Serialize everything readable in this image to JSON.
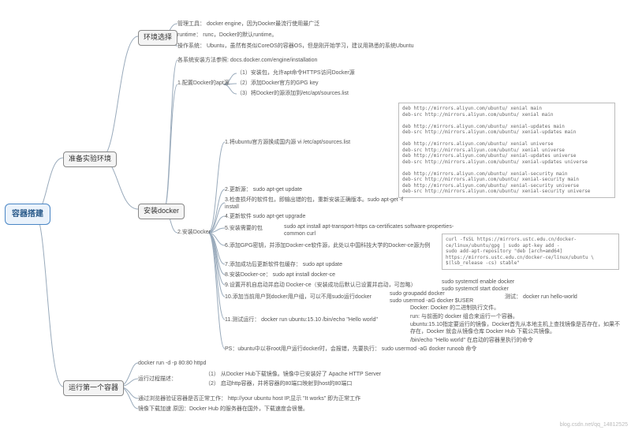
{
  "root": "容器搭建",
  "prep": "准备实验环境",
  "env": {
    "title": "环境选择",
    "tool": "管理工具： docker engine，因为Docker最流行使用最广泛",
    "runtime": "runtime： runc，Docker的默认runtime。",
    "os": "操作系统： Ubuntu，虽然有类似CoreOS的容器OS，但是刚开始学习，建议用熟悉的系统Ubuntu"
  },
  "install": {
    "title": "安装docker",
    "docs": "各系统安装方法参照: docs.docker.com/engine/installation",
    "apt": {
      "title": "1.配置Docker的apt源",
      "s1": "（1）安装包，允许apt命令HTTPS访问Docker源",
      "s2": "（2）添加Docker官方的GPG key",
      "s3": "（3）将Docker的源添加到/etc/apt/sources.list"
    },
    "do": {
      "title": "2.安装Docker",
      "s1": "1.将ubuntu官方源换成国内源 vi /etc/apt/sources.list",
      "s2": "2.更新源： sudo apt-get update",
      "s3": "3.检查损坏的软件包，即输出错的包，重新安装正确版本。sudo apt-get -f install",
      "s4": "4.更新软件 sudo apt-get upgrade",
      "s5": "5.安装需要的包",
      "s5cmd": "sudo apt install apt-transport-https ca-certificates software-properties-common curl",
      "s6": "6.添加GPG密钥，并添加Docker-ce软件源，此处以中国科技大学的Docker-ce源为例",
      "s7": "7.添加成功后更新软件包缓存： sudo apt update",
      "s8": "8.安装Docker-ce： sudo apt install docker-ce",
      "s9": "9.设置开机自启动并启动 Docker-ce（安装成功后默认已设置并启动，可忽略）",
      "s9cmd": "sudo systemctl enable docker\nsudo systemctl start docker",
      "s10": "10.添加当前用户到docker用户组，可以不用sudo运行docker",
      "s10cmd": "sudo groupadd docker\nsudo usermod -aG docker $USER",
      "s10test": "测试： docker run hello-world",
      "s11": "11.测试运行：   docker run ubuntu:15.10 /bin/echo \"Hello world\"",
      "s11a": "Docker: Docker 的二进制执行文件。",
      "s11b": "run: 与前面的 docker 组合来运行一个容器。",
      "s11c": "ubuntu:15.10指定要运行的镜像，Docker首先从本地主机上查找镜像是否存在，如果不存在，Docker 就会从镜像仓库 Docker Hub 下载公共镜像。",
      "s11d": "/bin/echo \"Hello world\"  在启动的容器里执行的命令",
      "sps": "PS：ubuntu中以非root用户运行docker时，会报错，先要执行：  sudo usermod -aG docker runoob 命令"
    }
  },
  "run": {
    "title": "运行第一个容器",
    "cmd": "docker run -d -p 80:80 httpd",
    "desc": "运行过程描述：",
    "d1": "（1） 从Docker Hub下载镜像。镜像中已安装好了 Apache HTTP Server",
    "d2": "（2） 启动http容器，并将容器的80端口映射到host的80端口",
    "verify": "通过浏览器验证容器是否正常工作：  http://your ubuntu host IP,显示 \"It works\" 即为正常工作",
    "slow": "镜像下载加速   原因：Docker Hub 的服务器在国外，下载速度会很慢。"
  },
  "mirrors": "deb http://mirrors.aliyun.com/ubuntu/ xenial main\ndeb-src http://mirrors.aliyun.com/ubuntu/ xenial main\n\ndeb http://mirrors.aliyun.com/ubuntu/ xenial-updates main\ndeb-src http://mirrors.aliyun.com/ubuntu/ xenial-updates main\n\ndeb http://mirrors.aliyun.com/ubuntu/ xenial universe\ndeb-src http://mirrors.aliyun.com/ubuntu/ xenial universe\ndeb http://mirrors.aliyun.com/ubuntu/ xenial-updates universe\ndeb-src http://mirrors.aliyun.com/ubuntu/ xenial-updates universe\n\ndeb http://mirrors.aliyun.com/ubuntu/ xenial-security main\ndeb-src http://mirrors.aliyun.com/ubuntu/ xenial-security main\ndeb http://mirrors.aliyun.com/ubuntu/ xenial-security universe\ndeb-src http://mirrors.aliyun.com/ubuntu/ xenial-security universe",
  "gpg": "curl -fsSL https://mirrors.ustc.edu.cn/docker-ce/linux/ubuntu/gpg | sudo apt-key add -\nsudo add-apt-repository \"deb [arch=amd64] https://mirrors.ustc.edu.cn/docker-ce/linux/ubuntu \\\n$(lsb_release -cs) stable\"",
  "watermark": "blog.csdn.net/qq_14812525"
}
